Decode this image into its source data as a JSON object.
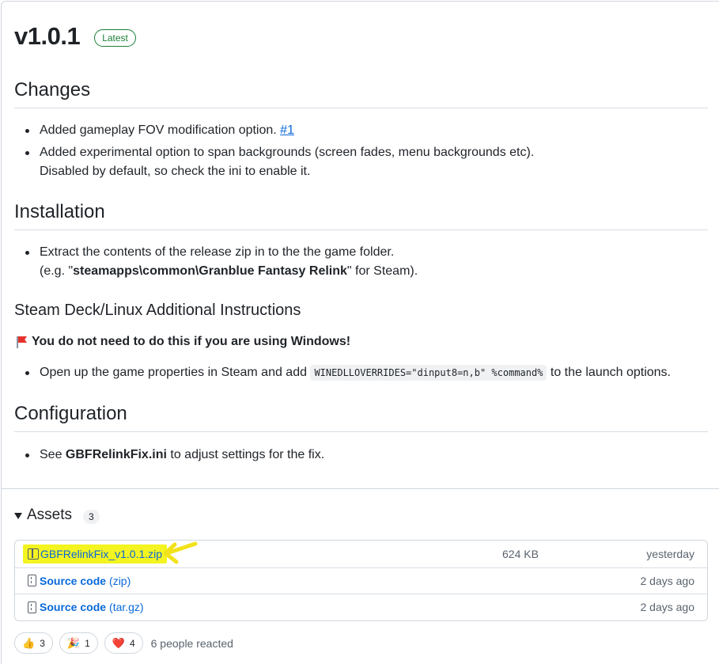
{
  "release": {
    "version": "v1.0.1",
    "badge": "Latest"
  },
  "changes": {
    "heading": "Changes",
    "item1_text": "Added gameplay FOV modification option. ",
    "item1_link": "#1",
    "item2_line1": "Added experimental option to span backgrounds (screen fades, menu backgrounds etc).",
    "item2_line2": "Disabled by default, so check the ini to enable it."
  },
  "installation": {
    "heading": "Installation",
    "line1": "Extract the contents of the release zip in to the the game folder.",
    "line2_pre": "(e.g. \"",
    "line2_bold": "steamapps\\common\\Granblue Fantasy Relink",
    "line2_post": "\" for Steam)."
  },
  "steam_deck": {
    "heading": "Steam Deck/Linux Additional Instructions",
    "warning": "You do not need to do this if you are using Windows!",
    "item_pre": "Open up the game properties in Steam and add ",
    "item_code": "WINEDLLOVERRIDES=\"dinput8=n,b\" %command%",
    "item_post": " to the launch options."
  },
  "configuration": {
    "heading": "Configuration",
    "item_pre": "See ",
    "item_bold": "GBFRelinkFix.ini",
    "item_post": " to adjust settings for the fix."
  },
  "assets": {
    "title": "Assets",
    "count": "3",
    "rows": [
      {
        "name": "GBFRelinkFix_v1.0.1.zip",
        "suffix": "",
        "size": "624 KB",
        "date": "yesterday",
        "icon": "package-icon"
      },
      {
        "name": "Source code",
        "suffix": "(zip)",
        "size": "",
        "date": "2 days ago",
        "icon": "file-zip-icon"
      },
      {
        "name": "Source code",
        "suffix": "(tar.gz)",
        "size": "",
        "date": "2 days ago",
        "icon": "file-zip-icon"
      }
    ]
  },
  "reactions": {
    "items": [
      {
        "emoji": "👍",
        "count": "3",
        "icon": "thumbs-up-icon"
      },
      {
        "emoji": "🎉",
        "count": "1",
        "icon": "hooray-icon"
      },
      {
        "emoji": "❤️",
        "count": "4",
        "icon": "heart-icon"
      }
    ],
    "summary": "6 people reacted"
  },
  "colors": {
    "link": "#0969da",
    "latest_badge": "#1a7f37",
    "highlight": "#f4f420",
    "annotation_arrow": "#f2e21a"
  }
}
